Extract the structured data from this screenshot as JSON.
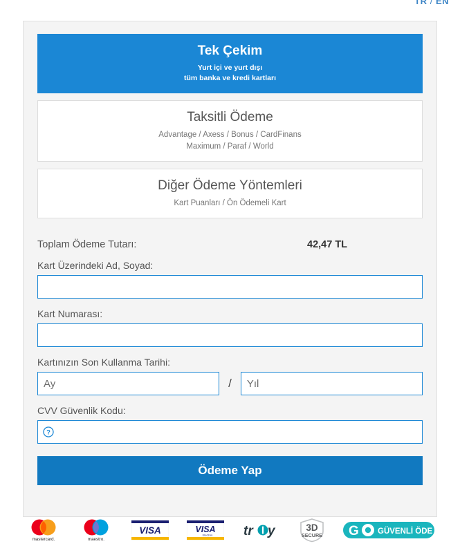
{
  "language_switcher": {
    "tr": "TR",
    "separator": "/",
    "en": "EN"
  },
  "methods": [
    {
      "id": "tek-cekim",
      "title": "Tek Çekim",
      "subtitle_line1": "Yurt içi ve yurt dışı",
      "subtitle_line2": "tüm banka ve kredi kartları",
      "active": true
    },
    {
      "id": "taksitli-odeme",
      "title": "Taksitli Ödeme",
      "subtitle_line1": "Advantage / Axess / Bonus / CardFinans",
      "subtitle_line2": "Maximum / Paraf / World",
      "active": false
    },
    {
      "id": "diger-odeme-yontemleri",
      "title": "Diğer Ödeme Yöntemleri",
      "subtitle_line1": "Kart Puanları / Ön Ödemeli Kart",
      "subtitle_line2": "",
      "active": false
    }
  ],
  "form": {
    "amount_label": "Toplam Ödeme Tutarı:",
    "amount_value": "42,47 TL",
    "cardholder_label": "Kart Üzerindeki Ad, Soyad:",
    "cardholder_value": "",
    "cardholder_placeholder": "",
    "cardnumber_label": "Kart Numarası:",
    "cardnumber_value": "",
    "cardnumber_placeholder": "",
    "expiry_label": "Kartınızın Son Kullanma Tarihi:",
    "expiry_month_placeholder": "Ay",
    "expiry_month_value": "",
    "expiry_separator": "/",
    "expiry_year_placeholder": "Yıl",
    "expiry_year_value": "",
    "cvv_label": "CVV Güvenlik Kodu:",
    "cvv_value": "",
    "cvv_placeholder": "",
    "cvv_help_icon": "question-circle-icon",
    "submit_label": "Ödeme Yap"
  },
  "logos": [
    {
      "id": "mastercard",
      "label": "mastercard."
    },
    {
      "id": "maestro",
      "label": "maestro."
    },
    {
      "id": "visa",
      "label": "VISA"
    },
    {
      "id": "visa-electron",
      "label": "VISA",
      "sublabel": "Electron"
    },
    {
      "id": "troy",
      "label": "troy"
    },
    {
      "id": "3d-secure",
      "label_top": "3D",
      "label_bottom": "SECURE"
    },
    {
      "id": "go-guvenli-ode",
      "label_mark": "GO",
      "label_text": "GÜVENLİ ÖDE"
    }
  ],
  "colors": {
    "primary_blue": "#1b87d5",
    "button_blue": "#1179c0",
    "card_background": "#f4f4f4",
    "card_border": "#e0e0e0",
    "input_border": "#1b87d5",
    "label_text": "#555555",
    "mastercard_red": "#eb001b",
    "mastercard_orange": "#f79e1b",
    "maestro_blue": "#00a1df",
    "visa_navy": "#1a1f71",
    "visa_gold": "#f7b600",
    "troy_teal": "#00a0af",
    "secure_gray": "#58595b",
    "go_teal": "#1ab5bd"
  }
}
